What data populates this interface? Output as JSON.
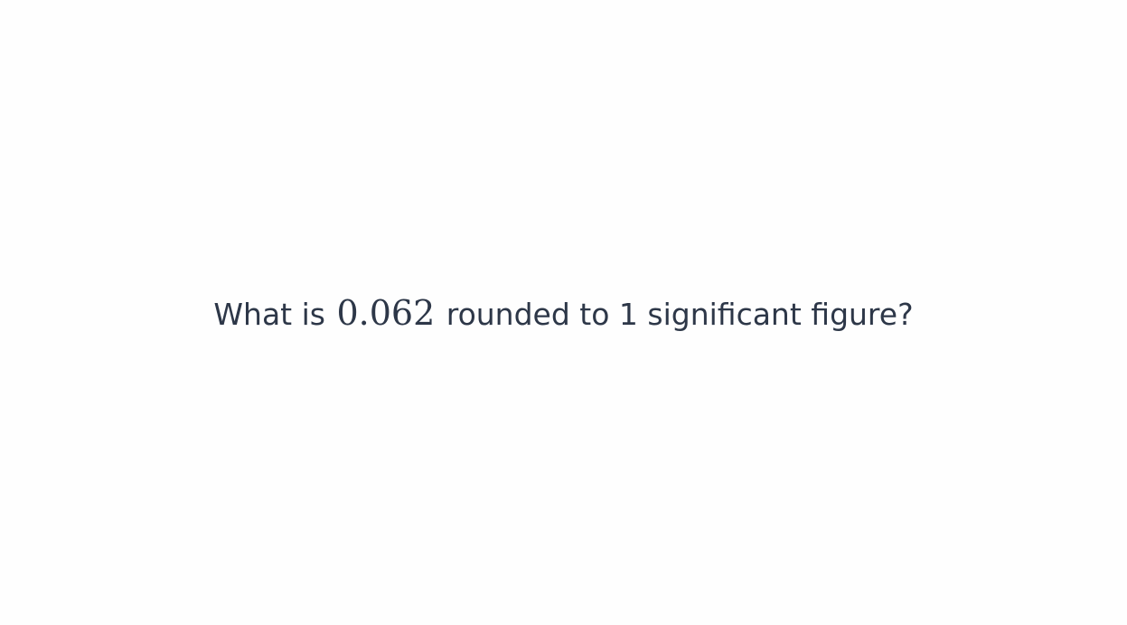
{
  "question": {
    "prefix": "What is ",
    "number": "0.062",
    "suffix": " rounded to 1 significant figure?"
  }
}
